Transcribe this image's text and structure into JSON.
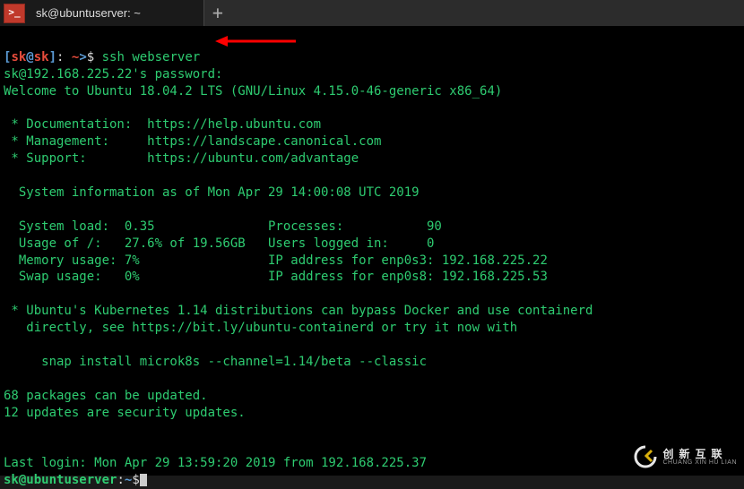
{
  "tab": {
    "title": "sk@ubuntuserver: ~",
    "icon_glyph": ">_"
  },
  "prompt1": {
    "bracket_open": "[",
    "user": "sk",
    "at": "@",
    "host": "sk",
    "bracket_close": "]",
    "sep": ": ",
    "path": "~",
    "gt": ">",
    "dollar": "$ ",
    "command": "ssh webserver"
  },
  "lines": {
    "pw": "sk@192.168.225.22's password:",
    "welcome": "Welcome to Ubuntu 18.04.2 LTS (GNU/Linux 4.15.0-46-generic x86_64)",
    "doc": " * Documentation:  https://help.ubuntu.com",
    "mgt": " * Management:     https://landscape.canonical.com",
    "sup": " * Support:        https://ubuntu.com/advantage",
    "sysinfo_hdr": "  System information as of Mon Apr 29 14:00:08 UTC 2019",
    "r1": "  System load:  0.35               Processes:           90",
    "r2": "  Usage of /:   27.6% of 19.56GB   Users logged in:     0",
    "r3": "  Memory usage: 7%                 IP address for enp0s3: 192.168.225.22",
    "r4": "  Swap usage:   0%                 IP address for enp0s8: 192.168.225.53",
    "k8s1": " * Ubuntu's Kubernetes 1.14 distributions can bypass Docker and use containerd",
    "k8s2": "   directly, see https://bit.ly/ubuntu-containerd or try it now with",
    "snap": "     snap install microk8s --channel=1.14/beta --classic",
    "pkg1": "68 packages can be updated.",
    "pkg2": "12 updates are security updates.",
    "last": "Last login: Mon Apr 29 13:59:20 2019 from 192.168.225.37"
  },
  "prompt2": {
    "user": "sk",
    "at": "@",
    "host": "ubuntuserver",
    "colon": ":",
    "path": "~",
    "dollar": "$"
  },
  "watermark": {
    "cn": "创新互联",
    "en": "CHUANG XIN HU LIAN"
  }
}
